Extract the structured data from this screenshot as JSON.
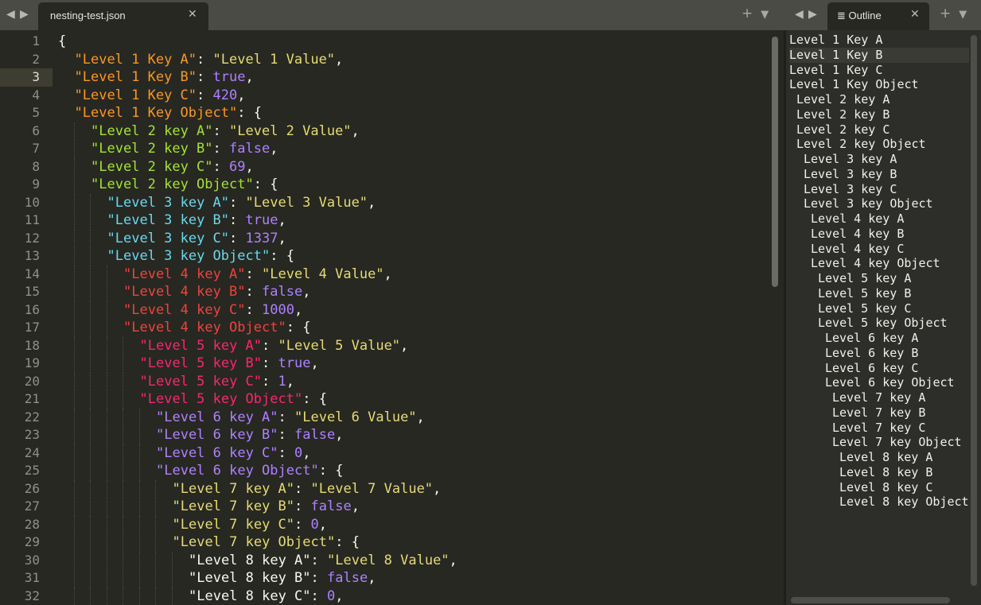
{
  "left_pane": {
    "nav_back": "◀",
    "nav_forward": "▶",
    "tab": {
      "label": "nesting-test.json",
      "close": "✕"
    },
    "add": "+",
    "menu": "▼"
  },
  "right_pane": {
    "nav_back": "◀",
    "nav_forward": "▶",
    "tab": {
      "icon": "≣",
      "label": "Outline",
      "close": "✕"
    },
    "add": "+",
    "menu": "▼"
  },
  "editor": {
    "current_line": 3,
    "line_numbers": [
      "1",
      "2",
      "3",
      "4",
      "5",
      "6",
      "7",
      "8",
      "9",
      "10",
      "11",
      "12",
      "13",
      "14",
      "15",
      "16",
      "17",
      "18",
      "19",
      "20",
      "21",
      "22",
      "23",
      "24",
      "25",
      "26",
      "27",
      "28",
      "29",
      "30",
      "31",
      "32"
    ],
    "lines": [
      {
        "indent": 0,
        "open": "{"
      },
      {
        "indent": 1,
        "level": 1,
        "key": "\"Level 1 Key A\"",
        "value": "\"Level 1 Value\"",
        "vtype": "str"
      },
      {
        "indent": 1,
        "level": 1,
        "key": "\"Level 1 Key B\"",
        "value": "true",
        "vtype": "bool"
      },
      {
        "indent": 1,
        "level": 1,
        "key": "\"Level 1 Key C\"",
        "value": "420",
        "vtype": "num"
      },
      {
        "indent": 1,
        "level": 1,
        "key": "\"Level 1 Key Object\"",
        "value": "{",
        "vtype": "open"
      },
      {
        "indent": 2,
        "level": 2,
        "key": "\"Level 2 key A\"",
        "value": "\"Level 2 Value\"",
        "vtype": "str"
      },
      {
        "indent": 2,
        "level": 2,
        "key": "\"Level 2 key B\"",
        "value": "false",
        "vtype": "bool"
      },
      {
        "indent": 2,
        "level": 2,
        "key": "\"Level 2 key C\"",
        "value": "69",
        "vtype": "num"
      },
      {
        "indent": 2,
        "level": 2,
        "key": "\"Level 2 key Object\"",
        "value": "{",
        "vtype": "open"
      },
      {
        "indent": 3,
        "level": 3,
        "key": "\"Level 3 key A\"",
        "value": "\"Level 3 Value\"",
        "vtype": "str"
      },
      {
        "indent": 3,
        "level": 3,
        "key": "\"Level 3 key B\"",
        "value": "true",
        "vtype": "bool"
      },
      {
        "indent": 3,
        "level": 3,
        "key": "\"Level 3 key C\"",
        "value": "1337",
        "vtype": "num"
      },
      {
        "indent": 3,
        "level": 3,
        "key": "\"Level 3 key Object\"",
        "value": "{",
        "vtype": "open"
      },
      {
        "indent": 4,
        "level": 4,
        "key": "\"Level 4 key A\"",
        "value": "\"Level 4 Value\"",
        "vtype": "str"
      },
      {
        "indent": 4,
        "level": 4,
        "key": "\"Level 4 key B\"",
        "value": "false",
        "vtype": "bool"
      },
      {
        "indent": 4,
        "level": 4,
        "key": "\"Level 4 key C\"",
        "value": "1000",
        "vtype": "num"
      },
      {
        "indent": 4,
        "level": 4,
        "key": "\"Level 4 key Object\"",
        "value": "{",
        "vtype": "open"
      },
      {
        "indent": 5,
        "level": 5,
        "key": "\"Level 5 key A\"",
        "value": "\"Level 5 Value\"",
        "vtype": "str"
      },
      {
        "indent": 5,
        "level": 5,
        "key": "\"Level 5 key B\"",
        "value": "true",
        "vtype": "bool"
      },
      {
        "indent": 5,
        "level": 5,
        "key": "\"Level 5 key C\"",
        "value": "1",
        "vtype": "num"
      },
      {
        "indent": 5,
        "level": 5,
        "key": "\"Level 5 key Object\"",
        "value": "{",
        "vtype": "open"
      },
      {
        "indent": 6,
        "level": 6,
        "key": "\"Level 6 key A\"",
        "value": "\"Level 6 Value\"",
        "vtype": "str"
      },
      {
        "indent": 6,
        "level": 6,
        "key": "\"Level 6 key B\"",
        "value": "false",
        "vtype": "bool"
      },
      {
        "indent": 6,
        "level": 6,
        "key": "\"Level 6 key C\"",
        "value": "0",
        "vtype": "num"
      },
      {
        "indent": 6,
        "level": 6,
        "key": "\"Level 6 key Object\"",
        "value": "{",
        "vtype": "open"
      },
      {
        "indent": 7,
        "level": 7,
        "key": "\"Level 7 key A\"",
        "value": "\"Level 7 Value\"",
        "vtype": "str"
      },
      {
        "indent": 7,
        "level": 7,
        "key": "\"Level 7 key B\"",
        "value": "false",
        "vtype": "bool"
      },
      {
        "indent": 7,
        "level": 7,
        "key": "\"Level 7 key C\"",
        "value": "0",
        "vtype": "num"
      },
      {
        "indent": 7,
        "level": 7,
        "key": "\"Level 7 key Object\"",
        "value": "{",
        "vtype": "open"
      },
      {
        "indent": 8,
        "level": 8,
        "key": "\"Level 8 key A\"",
        "value": "\"Level 8 Value\"",
        "vtype": "str"
      },
      {
        "indent": 8,
        "level": 8,
        "key": "\"Level 8 key B\"",
        "value": "false",
        "vtype": "bool"
      },
      {
        "indent": 8,
        "level": 8,
        "key": "\"Level 8 key C\"",
        "value": "0",
        "vtype": "num"
      }
    ]
  },
  "outline": {
    "hover_index": 1,
    "items": [
      {
        "depth": 0,
        "label": "Level 1 Key A"
      },
      {
        "depth": 0,
        "label": "Level 1 Key B"
      },
      {
        "depth": 0,
        "label": "Level 1 Key C"
      },
      {
        "depth": 0,
        "label": "Level 1 Key Object"
      },
      {
        "depth": 1,
        "label": "Level 2 key A"
      },
      {
        "depth": 1,
        "label": "Level 2 key B"
      },
      {
        "depth": 1,
        "label": "Level 2 key C"
      },
      {
        "depth": 1,
        "label": "Level 2 key Object"
      },
      {
        "depth": 2,
        "label": "Level 3 key A"
      },
      {
        "depth": 2,
        "label": "Level 3 key B"
      },
      {
        "depth": 2,
        "label": "Level 3 key C"
      },
      {
        "depth": 2,
        "label": "Level 3 key Object"
      },
      {
        "depth": 3,
        "label": "Level 4 key A"
      },
      {
        "depth": 3,
        "label": "Level 4 key B"
      },
      {
        "depth": 3,
        "label": "Level 4 key C"
      },
      {
        "depth": 3,
        "label": "Level 4 key Object"
      },
      {
        "depth": 4,
        "label": "Level 5 key A"
      },
      {
        "depth": 4,
        "label": "Level 5 key B"
      },
      {
        "depth": 4,
        "label": "Level 5 key C"
      },
      {
        "depth": 4,
        "label": "Level 5 key Object"
      },
      {
        "depth": 5,
        "label": "Level 6 key A"
      },
      {
        "depth": 5,
        "label": "Level 6 key B"
      },
      {
        "depth": 5,
        "label": "Level 6 key C"
      },
      {
        "depth": 5,
        "label": "Level 6 key Object"
      },
      {
        "depth": 6,
        "label": "Level 7 key A"
      },
      {
        "depth": 6,
        "label": "Level 7 key B"
      },
      {
        "depth": 6,
        "label": "Level 7 key C"
      },
      {
        "depth": 6,
        "label": "Level 7 key Object"
      },
      {
        "depth": 7,
        "label": "Level 8 key A"
      },
      {
        "depth": 7,
        "label": "Level 8 key B"
      },
      {
        "depth": 7,
        "label": "Level 8 key C"
      },
      {
        "depth": 7,
        "label": "Level 8 key Object"
      }
    ]
  }
}
